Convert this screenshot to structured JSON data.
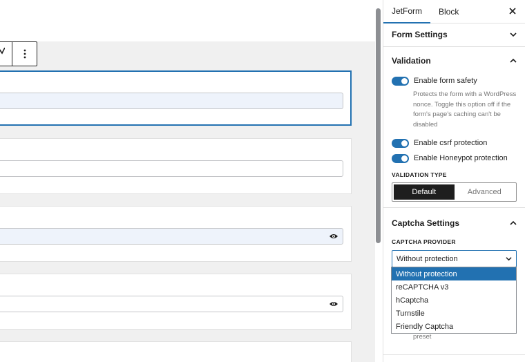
{
  "sidebar": {
    "tabs": [
      {
        "label": "JetForm"
      },
      {
        "label": "Block"
      }
    ],
    "form_settings": {
      "title": "Form Settings"
    },
    "validation": {
      "title": "Validation",
      "toggles": [
        {
          "label": "Enable form safety",
          "on": true
        },
        {
          "label": "Enable csrf protection",
          "on": true
        },
        {
          "label": "Enable Honeypot protection",
          "on": true
        }
      ],
      "form_safety_help": "Protects the form with a WordPress nonce. Toggle this option off if the form's page's caching can't be disabled",
      "type_label": "VALIDATION TYPE",
      "type_options": [
        {
          "label": "Default"
        },
        {
          "label": "Advanced"
        }
      ],
      "type_selected": "Default"
    },
    "captcha": {
      "title": "Captcha Settings",
      "provider_label": "CAPTCHA PROVIDER",
      "selected": "Without protection",
      "options": [
        {
          "label": "Without protection"
        },
        {
          "label": "reCAPTCHA v3"
        },
        {
          "label": "hCaptcha"
        },
        {
          "label": "Turnstile"
        },
        {
          "label": "Friendly Captcha"
        }
      ],
      "behind_text": "preset"
    }
  },
  "colors": {
    "accent": "#2271b1",
    "dark": "#1e1e1e",
    "border": "#e0e0e0",
    "canvas": "#f0f0f0"
  }
}
